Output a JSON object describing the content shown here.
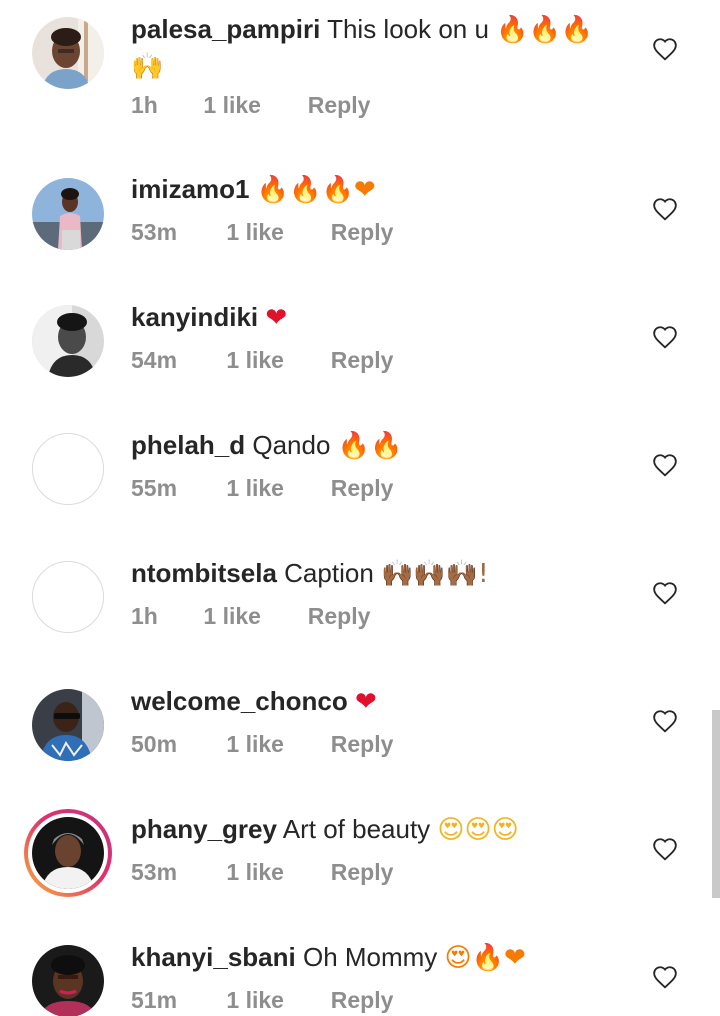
{
  "comments": [
    {
      "username": "palesa_pampiri",
      "text": "This look on u",
      "emoji_line1": "🔥🔥🔥",
      "emoji_line2": "🙌",
      "time": "1h",
      "likes": "1 like",
      "reply": "Reply",
      "avatar": "photo"
    },
    {
      "username": "imizamo1",
      "text": "",
      "emojis": "🔥🔥🔥❤",
      "time": "53m",
      "likes": "1 like",
      "reply": "Reply",
      "avatar": "photo"
    },
    {
      "username": "kanyindiki",
      "text": "",
      "emojis": "❤",
      "time": "54m",
      "likes": "1 like",
      "reply": "Reply",
      "avatar": "photo-grayscale"
    },
    {
      "username": "phelah_d",
      "text": "Qando",
      "emojis": "🔥🔥",
      "time": "55m",
      "likes": "1 like",
      "reply": "Reply",
      "avatar": "empty"
    },
    {
      "username": "ntombitsela",
      "text": "Caption",
      "emojis": "🙌🏾🙌🏾🙌🏾!",
      "time": "1h",
      "likes": "1 like",
      "reply": "Reply",
      "avatar": "empty"
    },
    {
      "username": "welcome_chonco",
      "text": "",
      "emojis": "❤",
      "time": "50m",
      "likes": "1 like",
      "reply": "Reply",
      "avatar": "photo"
    },
    {
      "username": "phany_grey",
      "text": "Art of beauty",
      "emojis": "😍😍😍",
      "time": "53m",
      "likes": "1 like",
      "reply": "Reply",
      "avatar": "photo-story"
    },
    {
      "username": "khanyi_sbani",
      "text": "Oh Mommy",
      "emojis": "😍🔥❤",
      "time": "51m",
      "likes": "1 like",
      "reply": "Reply",
      "avatar": "photo"
    }
  ],
  "icons": {
    "like": "heart-outline-icon"
  },
  "colors": {
    "text": "#262626",
    "meta": "#8e8e8e",
    "heart_emoji": "#e0112b",
    "fire_emoji": "#f57c00"
  }
}
